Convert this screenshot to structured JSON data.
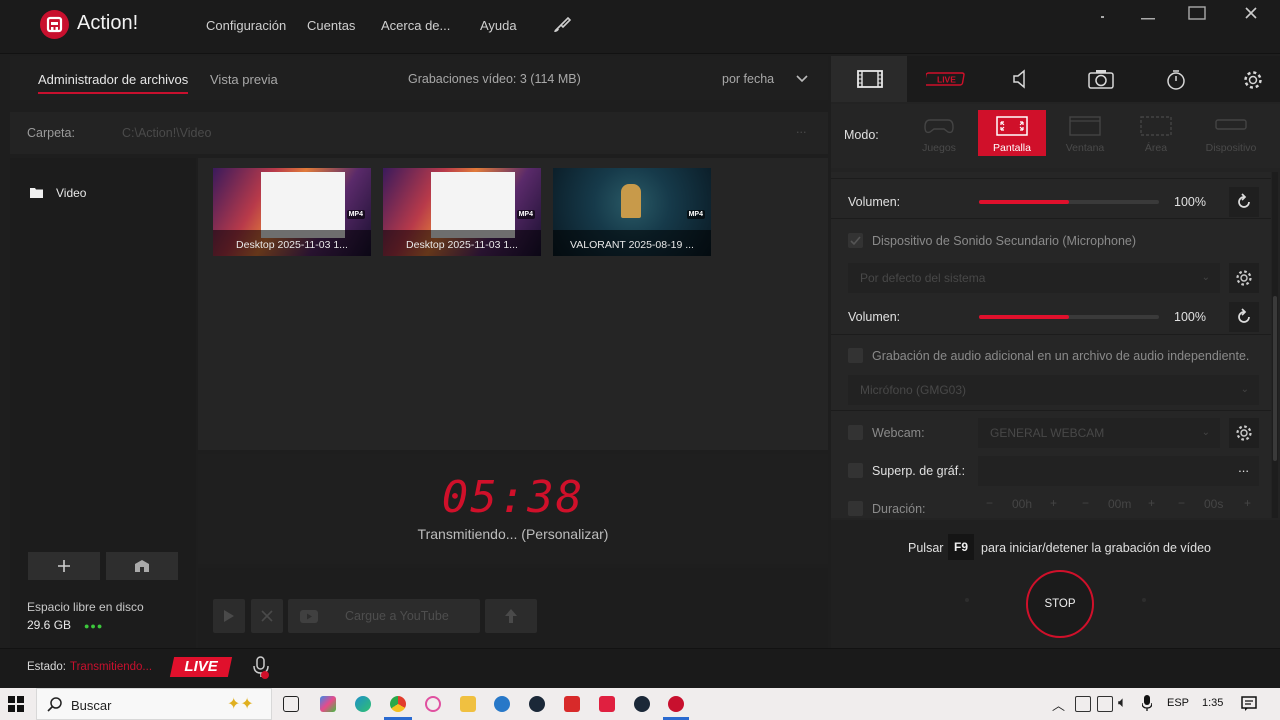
{
  "app": {
    "title": "Action!"
  },
  "menu": {
    "items": [
      "Configuración",
      "Cuentas",
      "Acerca de...",
      "Ayuda"
    ]
  },
  "file_manager": {
    "tabs": [
      "Administrador de archivos",
      "Vista previa"
    ],
    "recordings_info": "Grabaciones vídeo: 3 (114 MB)",
    "sort_label": "por fecha",
    "folder_label": "Carpeta:",
    "folder_path": "C:\\Action!\\Video",
    "folder_more": "...",
    "sidebar_items": [
      {
        "label": "Video",
        "icon": "folder-icon"
      }
    ],
    "thumbnails": [
      {
        "label": "Desktop 2025-11-03 1...",
        "badge": "MP4"
      },
      {
        "label": "Desktop 2025-11-03 1...",
        "badge": "MP4"
      },
      {
        "label": "VALORANT 2025-08-19 ...",
        "badge": "MP4"
      }
    ],
    "disk_label": "Espacio libre en disco",
    "disk_value": "29.6 GB"
  },
  "timer": {
    "value": "05:38",
    "status": "Transmitiendo... (Personalizar)"
  },
  "actions": {
    "upload_label": "Cargue a YouTube"
  },
  "status": {
    "label": "Estado:",
    "value": "Transmitiendo...",
    "live_badge": "LIVE"
  },
  "right_panel": {
    "tabs": [
      {
        "name": "video",
        "icon": "film-icon"
      },
      {
        "name": "live",
        "icon": "live-icon",
        "label": "LIVE"
      },
      {
        "name": "audio",
        "icon": "speaker-icon"
      },
      {
        "name": "screenshot",
        "icon": "camera-icon"
      },
      {
        "name": "benchmark",
        "icon": "stopwatch-icon"
      },
      {
        "name": "settings",
        "icon": "gear-icon"
      }
    ],
    "mode_label": "Modo:",
    "modes": [
      "Juegos",
      "Pantalla",
      "Ventana",
      "Área",
      "Dispositivo"
    ],
    "active_mode": "Pantalla",
    "settings": {
      "volume_label": "Volumen:",
      "volume1": "100%",
      "volume1_level": 0.5,
      "secondary_device": "Dispositivo de Sonido Secundario (Microphone)",
      "secondary_device_select": "Por defecto del sistema",
      "volume2": "100%",
      "volume2_level": 0.5,
      "extra_audio": "Grabación de audio adicional en un archivo de audio independiente.",
      "mic_select": "Micrófono (GMG03)",
      "webcam_label": "Webcam:",
      "webcam_select": "GENERAL WEBCAM",
      "overlay_label": "Superp. de gráf.:",
      "overlay_more": "...",
      "duration_label": "Duración:",
      "duration_h": "00h",
      "duration_m": "00m",
      "duration_s": "00s"
    },
    "record": {
      "press": "Pulsar",
      "key": "F9",
      "hint": "para iniciar/detener la grabación de vídeo",
      "stop_label": "STOP"
    }
  },
  "taskbar": {
    "search_placeholder": "Buscar",
    "language": "ESP",
    "time": "1:35"
  },
  "colors": {
    "accent": "#d0102a",
    "background": "#1e1e1e",
    "panel": "#262626"
  }
}
